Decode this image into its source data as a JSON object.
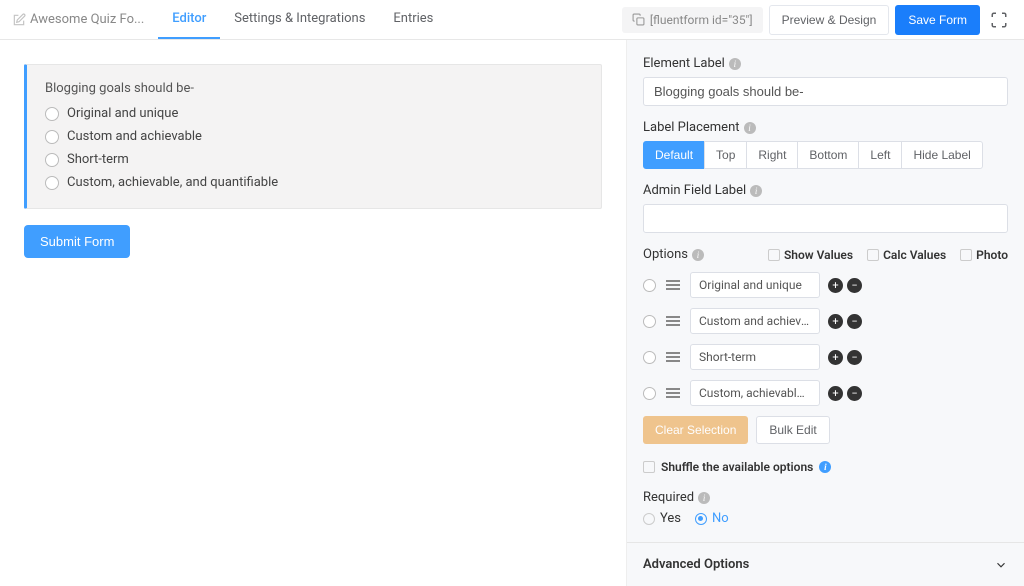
{
  "header": {
    "formName": "Awesome Quiz Fo...",
    "tabs": [
      "Editor",
      "Settings & Integrations",
      "Entries"
    ],
    "activeTab": "Editor",
    "shortcode": "[fluentform id=\"35\"]",
    "previewBtn": "Preview & Design",
    "saveBtn": "Save Form"
  },
  "canvas": {
    "questionLabel": "Blogging goals should be-",
    "choices": [
      "Original and unique",
      "Custom and achievable",
      "Short-term",
      "Custom, achievable, and quantifiable"
    ],
    "submitLabel": "Submit Form"
  },
  "sidebar": {
    "elementLabel": {
      "label": "Element Label",
      "value": "Blogging goals should be-"
    },
    "labelPlacement": {
      "label": "Label Placement",
      "options": [
        "Default",
        "Top",
        "Right",
        "Bottom",
        "Left",
        "Hide Label"
      ],
      "active": "Default"
    },
    "adminFieldLabel": {
      "label": "Admin Field Label",
      "value": ""
    },
    "options": {
      "label": "Options",
      "checks": [
        "Show Values",
        "Calc Values",
        "Photo"
      ],
      "items": [
        "Original and unique",
        "Custom and achievable",
        "Short-term",
        "Custom, achievable, and quantifiable"
      ],
      "clearBtn": "Clear Selection",
      "bulkBtn": "Bulk Edit"
    },
    "shuffle": "Shuffle the available options",
    "required": {
      "label": "Required",
      "yes": "Yes",
      "no": "No",
      "value": "No"
    },
    "advanced": "Advanced Options"
  }
}
